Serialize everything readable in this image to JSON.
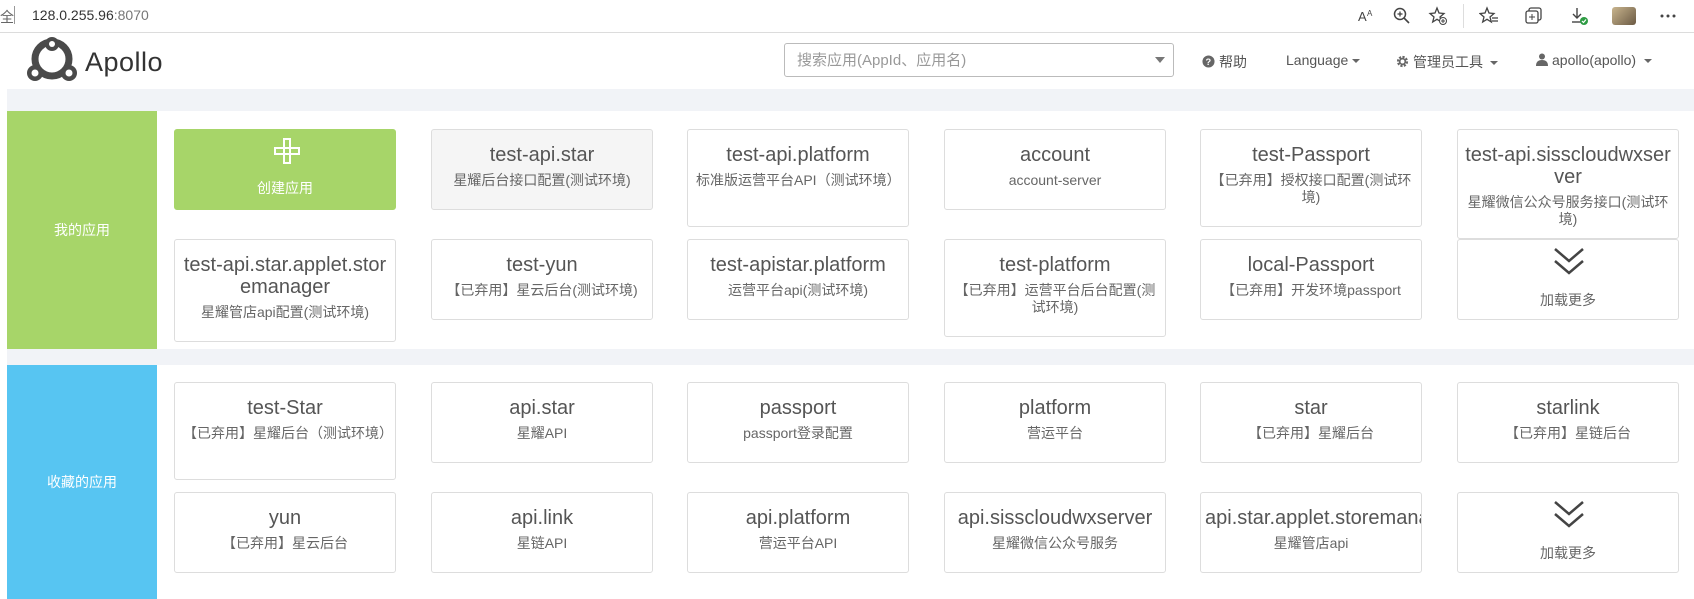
{
  "browser": {
    "left_glyph": "全",
    "url_host": "128.0.255.96",
    "url_port": ":8070",
    "toolbar_icons": [
      "read-aloud-icon",
      "zoom-icon",
      "add-favorite-icon",
      "favorites-icon",
      "collections-icon",
      "downloads-icon",
      "profile-icon",
      "more-icon"
    ]
  },
  "header": {
    "logo_text": "Apollo",
    "search_placeholder": "搜索应用(AppId、应用名)",
    "help_label": "帮助",
    "language_label": "Language",
    "admin_tools_label": "管理员工具",
    "user_label": "apollo(apollo)"
  },
  "colors": {
    "mine_accent": "#a7d569",
    "fav_accent": "#57c5f2"
  },
  "my_apps": {
    "title": "我的应用",
    "create_label": "创建应用",
    "load_more_label": "加载更多",
    "apps": [
      {
        "id": "test-api.star",
        "name": "星耀后台接口配置(测试环境)"
      },
      {
        "id": "test-api.platform",
        "name": "标准版运营平台API（测试环境）"
      },
      {
        "id": "account",
        "name": "account-server"
      },
      {
        "id": "test-Passport",
        "name": "【已弃用】授权接口配置(测试环境)"
      },
      {
        "id": "test-api.sisscloudwxserver",
        "name": "星耀微信公众号服务接口(测试环境)"
      },
      {
        "id": "test-api.star.applet.storemanager",
        "name": "星耀管店api配置(测试环境)"
      },
      {
        "id": "test-yun",
        "name": "【已弃用】星云后台(测试环境)"
      },
      {
        "id": "test-apistar.platform",
        "name": "运营平台api(测试环境)"
      },
      {
        "id": "test-platform",
        "name": "【已弃用】运营平台后台配置(测试环境)"
      },
      {
        "id": "local-Passport",
        "name": "【已弃用】开发环境passport"
      }
    ]
  },
  "fav_apps": {
    "title": "收藏的应用",
    "load_more_label": "加载更多",
    "apps": [
      {
        "id": "test-Star",
        "name": "【已弃用】星耀后台（测试环境）"
      },
      {
        "id": "api.star",
        "name": "星耀API"
      },
      {
        "id": "passport",
        "name": "passport登录配置"
      },
      {
        "id": "platform",
        "name": "营运平台"
      },
      {
        "id": "star",
        "name": "【已弃用】星耀后台"
      },
      {
        "id": "starlink",
        "name": "【已弃用】星链后台"
      },
      {
        "id": "yun",
        "name": "【已弃用】星云后台"
      },
      {
        "id": "api.link",
        "name": "星链API"
      },
      {
        "id": "api.platform",
        "name": "营运平台API"
      },
      {
        "id": "api.sisscloudwxserver",
        "name": "星耀微信公众号服务"
      },
      {
        "id": "api.star.applet.storemanager",
        "name": "星耀管店api"
      }
    ]
  }
}
